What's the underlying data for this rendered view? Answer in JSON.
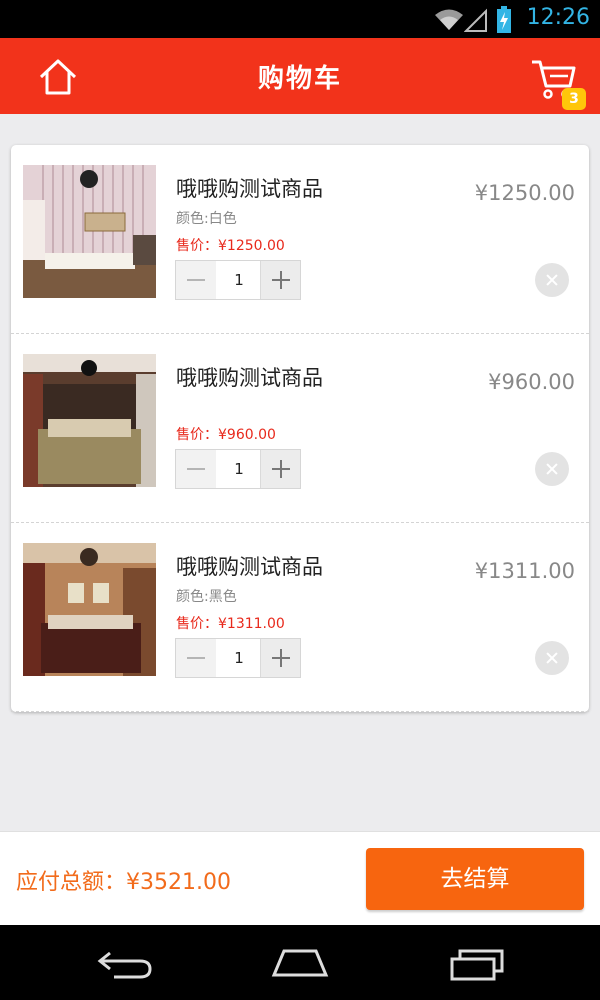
{
  "status_bar": {
    "time": "12:26"
  },
  "header": {
    "title": "购物车",
    "cart_badge": "3"
  },
  "items": [
    {
      "name": "哦哦购测试商品",
      "price": "¥1250.00",
      "color": "颜色:白色",
      "sale_price": "售价：¥1250.00",
      "quantity": "1"
    },
    {
      "name": "哦哦购测试商品",
      "price": "¥960.00",
      "color": "",
      "sale_price": "售价：¥960.00",
      "quantity": "1"
    },
    {
      "name": "哦哦购测试商品",
      "price": "¥1311.00",
      "color": "颜色:黑色",
      "sale_price": "售价：¥1311.00",
      "quantity": "1"
    }
  ],
  "footer": {
    "total": "应付总额：¥3521.00",
    "checkout_label": "去结算"
  },
  "colors": {
    "header": "#f2331b",
    "checkout": "#f7650f",
    "total_text": "#f26b1b",
    "sale_price": "#e8291c",
    "badge": "#ffc60a"
  }
}
